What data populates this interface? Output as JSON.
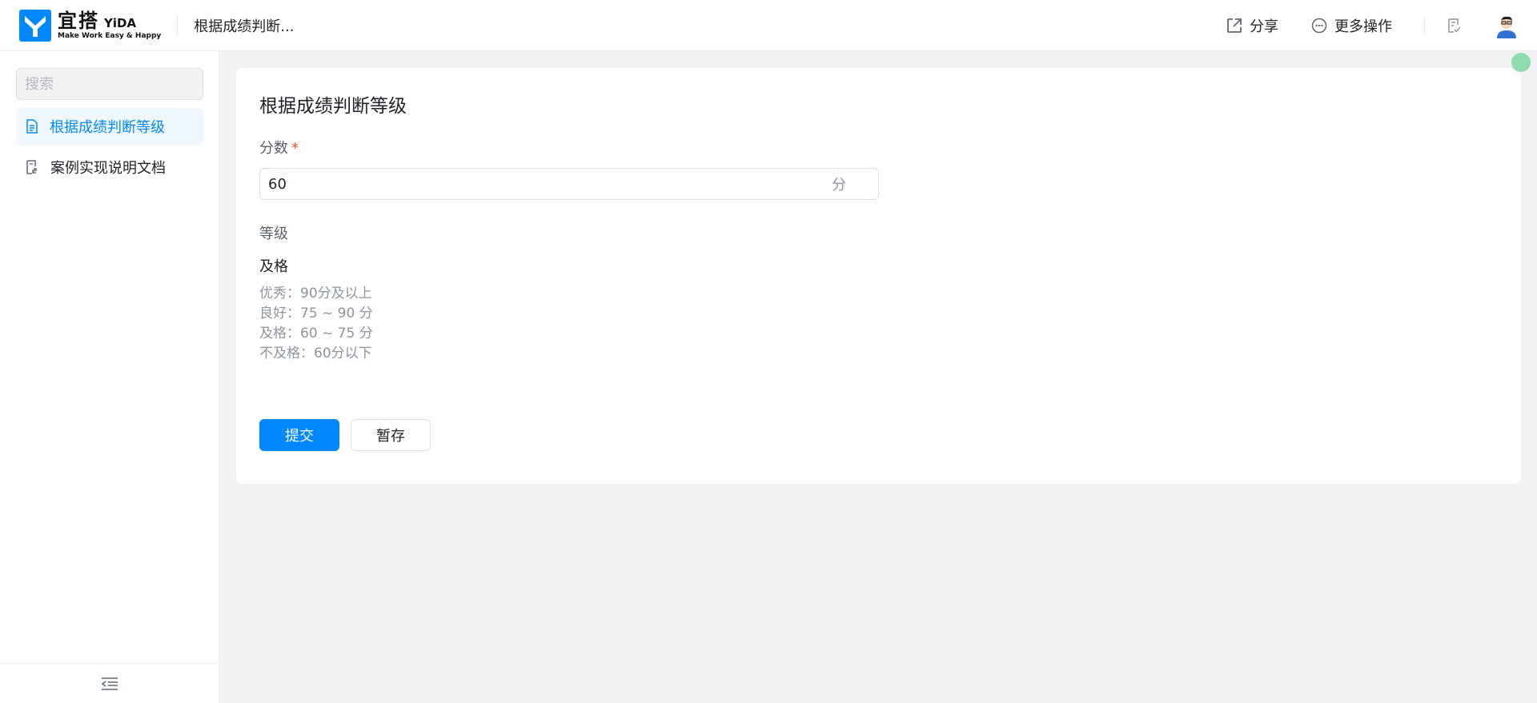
{
  "header": {
    "logo_cn": "宜搭",
    "logo_en": "YiDA",
    "logo_sub": "Make Work Easy & Happy",
    "app_name": "根据成绩判断...",
    "share_label": "分享",
    "more_label": "更多操作",
    "accent": "#0089ff"
  },
  "sidebar": {
    "search_placeholder": "搜索",
    "items": [
      {
        "label": "根据成绩判断等级",
        "icon": "document-icon",
        "active": true
      },
      {
        "label": "案例实现说明文档",
        "icon": "doc-link-icon",
        "active": false
      }
    ]
  },
  "form": {
    "title": "根据成绩判断等级",
    "score_label": "分数",
    "required_mark": "*",
    "score_value": "60",
    "score_unit": "分",
    "grade_label": "等级",
    "grade_value": "及格",
    "rules": [
      "优秀：90分及以上",
      "良好：75 ~ 90 分",
      "及格：60 ~ 75 分",
      "不及格：60分以下"
    ],
    "submit_label": "提交",
    "save_label": "暂存"
  }
}
